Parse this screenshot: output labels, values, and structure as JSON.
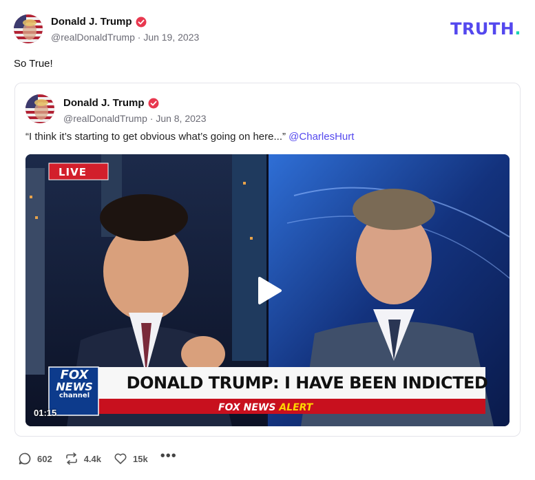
{
  "brand": {
    "logo_text": "TRUTH",
    "logo_dot": ".",
    "primary_color": "#5448ee",
    "accent_color": "#19d3b3"
  },
  "post": {
    "author": {
      "display_name": "Donald J. Trump",
      "handle": "@realDonaldTrump",
      "verified": true
    },
    "date": "Jun 19, 2023",
    "meta_separator": " · ",
    "text": "So True!"
  },
  "quote": {
    "author": {
      "display_name": "Donald J. Trump",
      "handle": "@realDonaldTrump",
      "verified": true
    },
    "date": "Jun 8, 2023",
    "meta_separator": " · ",
    "text": "“I think it’s starting to get obvious what’s going on here...”",
    "mention": "@CharlesHurt",
    "video": {
      "duration": "01:15",
      "live_badge": "LIVE",
      "headline": "DONALD TRUMP: I HAVE BEEN INDICTED",
      "alert_prefix": "FOX NEWS",
      "alert_word": "ALERT",
      "network_logo": [
        "FOX",
        "NEWS",
        "channel"
      ],
      "play_icon": "play-icon"
    }
  },
  "actions": [
    {
      "name": "reply",
      "icon": "reply-icon",
      "count": "602"
    },
    {
      "name": "retruth",
      "icon": "retruth-icon",
      "count": "4.4k"
    },
    {
      "name": "like",
      "icon": "heart-icon",
      "count": "15k"
    }
  ],
  "more_icon": "more-icon"
}
